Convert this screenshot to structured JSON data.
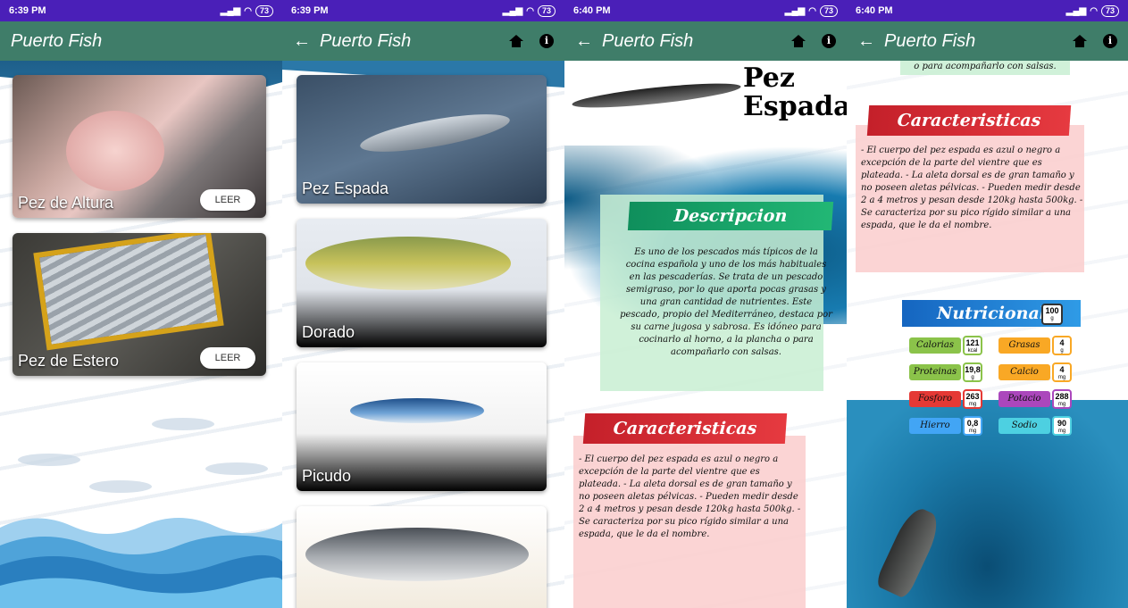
{
  "status": [
    {
      "time": "6:39 PM",
      "battery": "73"
    },
    {
      "time": "6:39 PM",
      "battery": "73"
    },
    {
      "time": "6:40 PM",
      "battery": "73"
    },
    {
      "time": "6:40 PM",
      "battery": "73"
    }
  ],
  "app": {
    "title": "Puerto Fish",
    "back": "←"
  },
  "screen1": {
    "cards": [
      {
        "label": "Pez de Altura",
        "button": "LEER"
      },
      {
        "label": "Pez de Estero",
        "button": "LEER"
      }
    ]
  },
  "screen2": {
    "cards": [
      {
        "label": "Pez Espada"
      },
      {
        "label": "Dorado"
      },
      {
        "label": "Picudo"
      },
      {
        "label": ""
      }
    ]
  },
  "screen3": {
    "header_title_1": "Pez",
    "header_title_2": "Espada",
    "descripcion_title": "Descripcion",
    "descripcion_text": "Es uno de los pescados más típicos de la cocina española y uno de los más habituales en las pescaderías. Se trata de un pescado semigraso, por lo que aporta pocas grasas y una gran cantidad de nutrientes. Este pescado, propio del Mediterráneo, destaca por su carne jugosa y sabrosa. Es idóneo para cocinarlo al horno, a la plancha o para acompañarlo con salsas.",
    "caracteristicas_title": "Caracteristicas",
    "caracteristicas_text": "- El cuerpo del pez espada es azul o negro a excepción de la parte del vientre que es plateada. - La aleta dorsal es de gran tamaño y no poseen aletas pélvicas. - Pueden medir desde 2 a 4 metros y pesan desde 120kg hasta 500kg. - Se caracteriza por su pico rígido similar a una espada, que le da el nombre."
  },
  "screen4": {
    "top_text": "o para acompañarlo con salsas.",
    "caracteristicas_title": "Caracteristicas",
    "caracteristicas_text": "- El cuerpo del pez espada es azul o negro a excepción de la parte del vientre que es plateada. - La aleta dorsal es de gran tamaño y no poseen aletas pélvicas. - Pueden medir desde 2 a 4 metros y pesan desde 120kg hasta 500kg. - Se caracteriza por su pico rígido similar a una espada, que le da el nombre.",
    "nutricional_title": "Nutricional",
    "portion": {
      "value": "100",
      "unit": "g"
    },
    "nutrients": [
      {
        "name": "Calorias",
        "value": "121",
        "unit": "kcal",
        "color": "#8bc34a"
      },
      {
        "name": "Grasas",
        "value": "4",
        "unit": "g",
        "color": "#f9a825"
      },
      {
        "name": "Proteinas",
        "value": "19,8",
        "unit": "g",
        "color": "#8bc34a"
      },
      {
        "name": "Calcio",
        "value": "4",
        "unit": "mg",
        "color": "#f9a825"
      },
      {
        "name": "Fosforo",
        "value": "263",
        "unit": "mg",
        "color": "#e53935"
      },
      {
        "name": "Potacio",
        "value": "288",
        "unit": "mg",
        "color": "#ab47bc"
      },
      {
        "name": "Hierro",
        "value": "0,8",
        "unit": "mg",
        "color": "#42a5f5"
      },
      {
        "name": "Sodio",
        "value": "90",
        "unit": "mg",
        "color": "#4dd0e1"
      }
    ]
  },
  "colors": {
    "statusbar": "#4a1fb8",
    "appbar": "#3f7d69",
    "banner_green": "#1aa36b",
    "banner_red": "#d92b35",
    "banner_blue": "#1e88e5"
  }
}
